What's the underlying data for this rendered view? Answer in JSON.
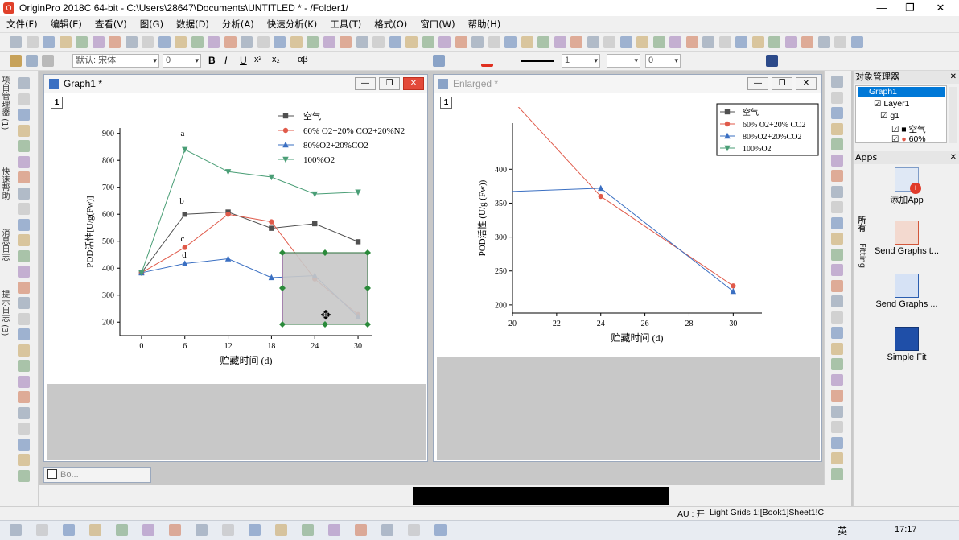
{
  "window": {
    "title": "OriginPro 2018C 64-bit - C:\\Users\\28647\\Documents\\UNTITLED * - /Folder1/",
    "minimize": "—",
    "maximize": "❐",
    "close": "✕"
  },
  "menu": [
    "文件(F)",
    "编辑(E)",
    "查看(V)",
    "图(G)",
    "数据(D)",
    "分析(A)",
    "快速分析(K)",
    "工具(T)",
    "格式(O)",
    "窗口(W)",
    "帮助(H)"
  ],
  "format_toolbar": {
    "font": "默认: 宋体",
    "font_size": "0",
    "bold": "B",
    "italic": "I",
    "underline": "U",
    "superscript": "x²",
    "subscript": "x₂",
    "greek": "αβ",
    "line_width": "1",
    "line_color_value": "0"
  },
  "left_vertical_tabs": [
    "项目管理器 (1)",
    "快速帮助",
    "消息日志",
    "提示日志 (3)"
  ],
  "graph1": {
    "title": "Graph1 *",
    "layer": "1",
    "legend": [
      "空气",
      "60% O2+20% CO2+20%N2",
      "80%O2+20%CO2",
      "100%O2"
    ],
    "annotations": [
      "a",
      "b",
      "c",
      "d"
    ]
  },
  "enlarged": {
    "title": "Enlarged *",
    "layer": "1",
    "legend": [
      "空气",
      "60% O2+20% CO2",
      "80%O2+20%CO2",
      "100%O2"
    ]
  },
  "chart_data": [
    {
      "type": "line",
      "xlabel": "贮藏时间 (d)",
      "ylabel": "POD活性[U/g(Fw)]",
      "xlim": [
        -3,
        32
      ],
      "ylim": [
        150,
        920
      ],
      "x_ticks": [
        "0",
        "6",
        "12",
        "18",
        "24",
        "30"
      ],
      "y_ticks": [
        "200",
        "300",
        "400",
        "500",
        "600",
        "700",
        "800",
        "900"
      ],
      "x": [
        0,
        6,
        12,
        18,
        24,
        30
      ],
      "series": [
        {
          "name": "空气",
          "color": "#505050",
          "marker": "square",
          "values": [
            383,
            600,
            608,
            548,
            565,
            498
          ]
        },
        {
          "name": "60% O2+20% CO2+20%N2",
          "color": "#e05a4a",
          "marker": "circle",
          "values": [
            383,
            477,
            600,
            572,
            360,
            228
          ]
        },
        {
          "name": "80%O2+20%CO2",
          "color": "#3a6fc2",
          "marker": "triangle-up",
          "values": [
            383,
            417,
            435,
            365,
            372,
            220
          ]
        },
        {
          "name": "100%O2",
          "color": "#4a9e76",
          "marker": "triangle-down",
          "values": [
            383,
            840,
            758,
            738,
            675,
            682
          ]
        }
      ]
    },
    {
      "type": "line",
      "xlabel": "贮藏时间 (d)",
      "ylabel": "POD活性 (U/g (Fw))",
      "xlim": [
        20,
        31.3
      ],
      "ylim": [
        188,
        468
      ],
      "x_ticks": [
        "20",
        "22",
        "24",
        "26",
        "28",
        "30"
      ],
      "y_ticks": [
        "200",
        "250",
        "300",
        "350",
        "400"
      ],
      "x": [
        18,
        24,
        30
      ],
      "series": [
        {
          "name": "60% O2+20% CO2",
          "color": "#e05a4a",
          "marker": "circle",
          "values": [
            572,
            360,
            228
          ]
        },
        {
          "name": "80%O2+20%CO2",
          "color": "#3a6fc2",
          "marker": "triangle-up",
          "values": [
            365,
            372,
            220
          ]
        }
      ]
    }
  ],
  "object_manager": {
    "title": "对象管理器",
    "items": [
      "Graph1",
      "Layer1",
      "g1",
      "空气",
      "60%"
    ]
  },
  "apps": {
    "title": "Apps",
    "side_tabs": [
      "所有",
      "Fitting"
    ],
    "items": [
      "添加App",
      "Send Graphs t...",
      "Send Graphs ...",
      "Simple Fit"
    ]
  },
  "minimized_window": "Bo...",
  "status": {
    "au": "AU : 开",
    "grid": "Light Grids",
    "sheet": "1:[Book1]Sheet1!C"
  },
  "taskbar": {
    "ime": "英",
    "time": "17:17"
  },
  "colors": {
    "accent": "#0078d7",
    "series_gray": "#505050",
    "series_red": "#e05a4a",
    "series_blue": "#3a6fc2",
    "series_green": "#4a9e76"
  }
}
